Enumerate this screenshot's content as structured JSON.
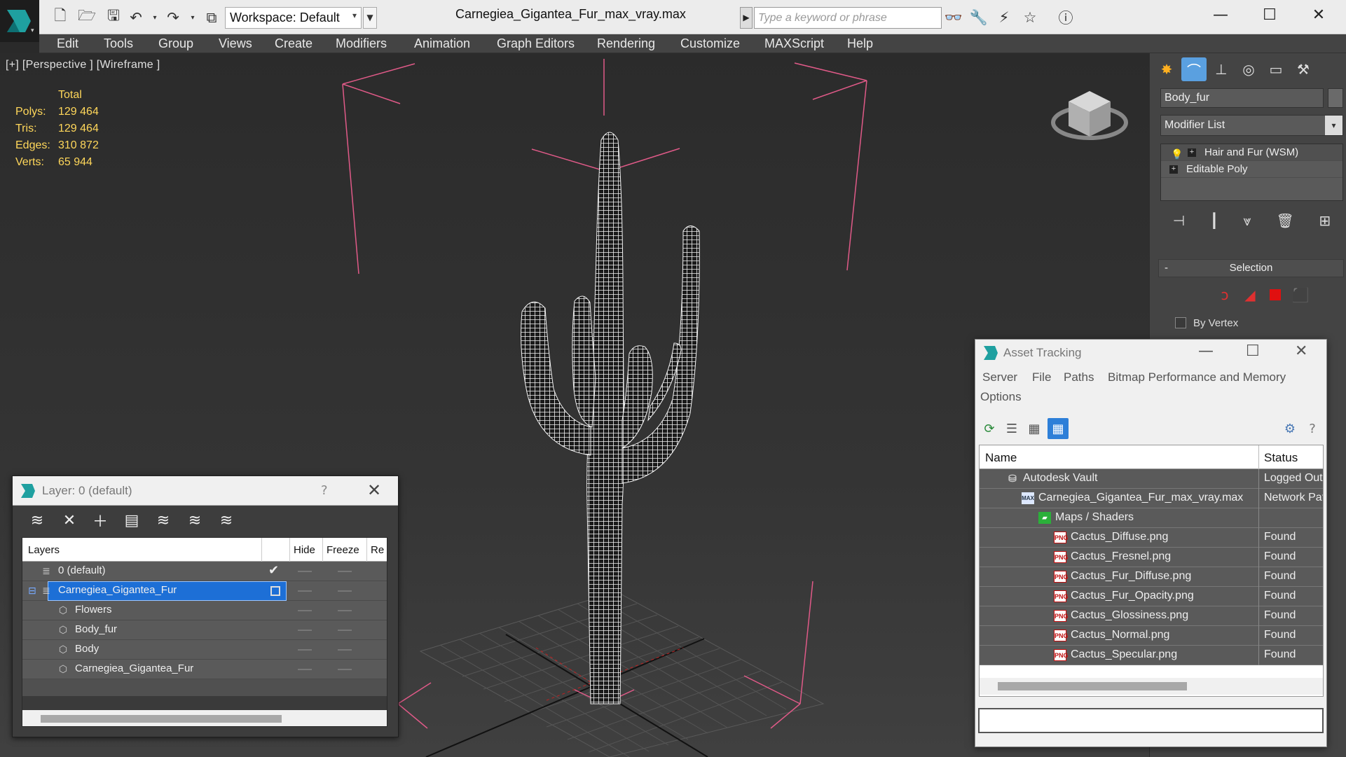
{
  "titlebar": {
    "workspace": "Workspace: Default",
    "doc_title": "Carnegiea_Gigantea_Fur_max_vray.max",
    "search_placeholder": "Type a keyword or phrase"
  },
  "menu": [
    "Edit",
    "Tools",
    "Group",
    "Views",
    "Create",
    "Modifiers",
    "Animation",
    "Graph Editors",
    "Rendering",
    "Customize",
    "MAXScript",
    "Help"
  ],
  "viewport": {
    "label": "[+] [Perspective ] [Wireframe ]",
    "stats_header": "Total",
    "stats": [
      {
        "label": "Polys:",
        "value": "129 464"
      },
      {
        "label": "Tris:",
        "value": "129 464"
      },
      {
        "label": "Edges:",
        "value": "310 872"
      },
      {
        "label": "Verts:",
        "value": "65 944"
      }
    ]
  },
  "command_panel": {
    "object_name": "Body_fur",
    "modifier_list": "Modifier List",
    "stack": [
      "Hair and Fur (WSM)",
      "Editable Poly"
    ],
    "rollout": "Selection",
    "rollout_toggle": "-",
    "by_vertex": "By Vertex"
  },
  "layer_window": {
    "title": "Layer: 0 (default)",
    "columns": {
      "layers": "Layers",
      "hide": "Hide",
      "freeze": "Freeze",
      "render": "Re"
    },
    "rows": [
      {
        "name": "0 (default)"
      },
      {
        "name": "Carnegiea_Gigantea_Fur"
      },
      {
        "name": "Flowers"
      },
      {
        "name": "Body_fur"
      },
      {
        "name": "Body"
      },
      {
        "name": "Carnegiea_Gigantea_Fur"
      }
    ]
  },
  "asset_window": {
    "title": "Asset Tracking",
    "menu": [
      "Server",
      "File",
      "Paths",
      "Bitmap Performance and Memory",
      "Options"
    ],
    "columns": {
      "name": "Name",
      "status": "Status"
    },
    "rows": [
      {
        "name": "Autodesk Vault",
        "status": "Logged Out"
      },
      {
        "name": "Carnegiea_Gigantea_Fur_max_vray.max",
        "status": "Network Path"
      },
      {
        "name": "Maps / Shaders",
        "status": ""
      },
      {
        "name": "Cactus_Diffuse.png",
        "status": "Found"
      },
      {
        "name": "Cactus_Fresnel.png",
        "status": "Found"
      },
      {
        "name": "Cactus_Fur_Diffuse.png",
        "status": "Found"
      },
      {
        "name": "Cactus_Fur_Opacity.png",
        "status": "Found"
      },
      {
        "name": "Cactus_Glossiness.png",
        "status": "Found"
      },
      {
        "name": "Cactus_Normal.png",
        "status": "Found"
      },
      {
        "name": "Cactus_Specular.png",
        "status": "Found"
      }
    ]
  },
  "colors": {
    "accent_blue": "#1d6fd6",
    "stats_yellow": "#ffd75a",
    "bbox_pink": "#e05a88",
    "wire_white": "#ffffff"
  },
  "icons": [
    "logo-icon",
    "new-file-icon",
    "open-file-icon",
    "save-icon",
    "undo-icon",
    "redo-icon",
    "project-icon",
    "binoculars-icon",
    "key-icon",
    "star-icon",
    "help-icon",
    "minimize-icon",
    "maximize-icon",
    "close-icon",
    "viewcube-icon"
  ]
}
